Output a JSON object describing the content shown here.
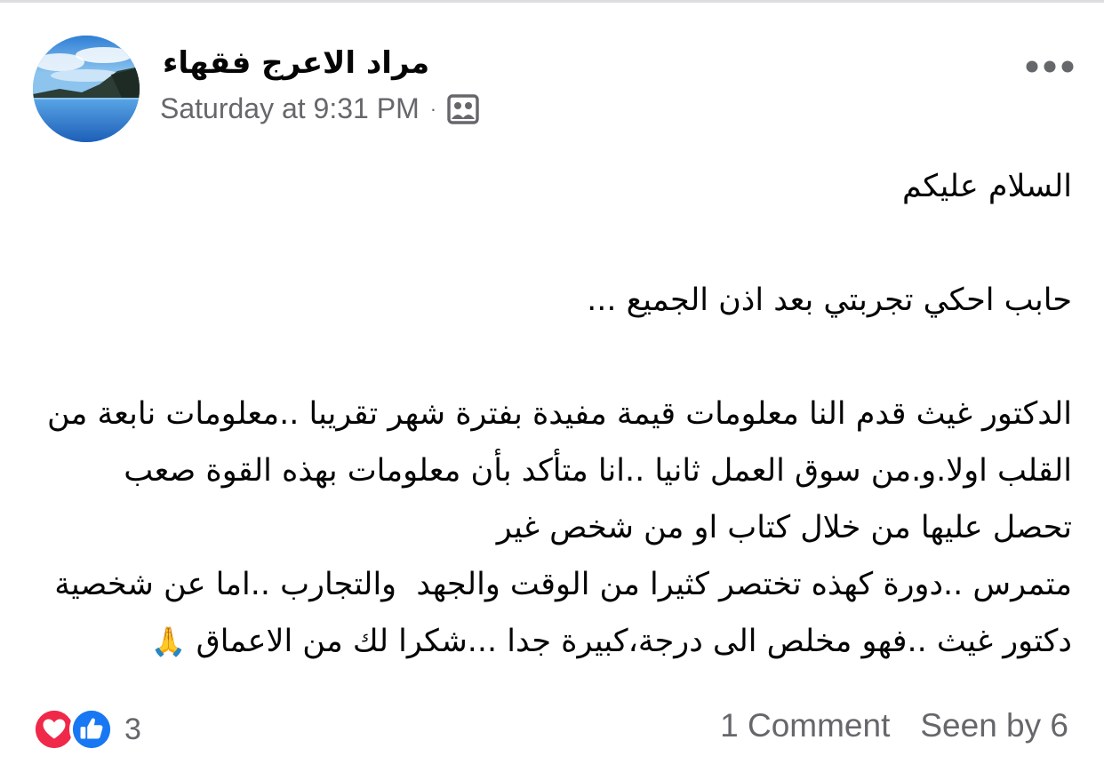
{
  "post": {
    "author": "مراد الاعرج فقهاء",
    "timestamp": "Saturday at 9:31 PM",
    "separator": "·",
    "audience_icon": "group-audience-icon",
    "more_icon": "more-options-icon",
    "body": "السلام عليكم\n\nحابب احكي تجربتي بعد اذن الجميع ...\n\nالدكتور غيث قدم النا معلومات قيمة مفيدة بفترة شهر تقريبا ..معلومات نابعة من القلب اولا.و.من سوق العمل ثانيا ..انا متأكد بأن معلومات بهذه القوة صعب تحصل عليها من خلال كتاب او من شخص غير\nمتمرس ..دورة كهذه تختصر كثيرا من الوقت والجهد  والتجارب ..اما عن شخصية دكتور غيث ..فهو مخلص الى درجة،كبيرة جدا ...شكرا لك من الاعماق ",
    "body_emoji": "🙏"
  },
  "footer": {
    "reaction_icons": [
      "love-reaction-icon",
      "like-reaction-icon"
    ],
    "reaction_count": "3",
    "comments": "1 Comment",
    "seen_by": "Seen by 6"
  },
  "colors": {
    "text_primary": "#050505",
    "text_secondary": "#65676b",
    "love": "#f0284a",
    "like": "#1877f2"
  }
}
